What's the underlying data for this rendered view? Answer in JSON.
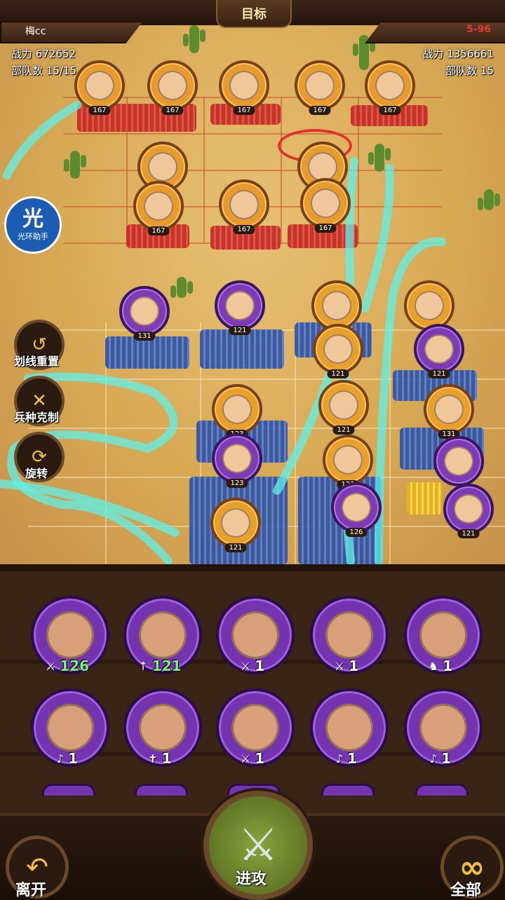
{
  "header": {
    "target_label": "目标"
  },
  "player": {
    "name": "梅cc",
    "power_label": "战力",
    "power": "672652",
    "troops_label": "部队数",
    "troops": "15/15"
  },
  "enemy": {
    "stage": "5-96",
    "power_label": "战力",
    "power": "1356661",
    "troops_label": "部队数",
    "troops": "15"
  },
  "halo_assistant": {
    "glyph": "光",
    "label": "光环助手"
  },
  "side_buttons": [
    {
      "name": "reset-lines",
      "label": "划线重置",
      "icon": "undo-icon"
    },
    {
      "name": "counter-chart",
      "label": "兵种克制",
      "icon": "crossed-swords-icon"
    },
    {
      "name": "rotate",
      "label": "旋转",
      "icon": "rotate-icon"
    }
  ],
  "enemy_units": [
    {
      "count": "167"
    },
    {
      "count": "167"
    },
    {
      "count": "167"
    },
    {
      "count": "167"
    },
    {
      "count": "167"
    },
    {
      "count": "167"
    },
    {
      "count": "167"
    },
    {
      "count": "167"
    },
    {
      "count": "167"
    },
    {
      "count": "167"
    }
  ],
  "ally_units": [
    {
      "count": "131"
    },
    {
      "count": "121"
    },
    {
      "count": "121"
    },
    {
      "count": "121"
    },
    {
      "count": "121"
    },
    {
      "count": "123"
    },
    {
      "count": "121"
    },
    {
      "count": "131"
    },
    {
      "count": "123"
    },
    {
      "count": "123"
    },
    {
      "count": "121"
    },
    {
      "count": "126"
    },
    {
      "count": "121"
    }
  ],
  "roster": [
    {
      "count": "126",
      "type": "sword",
      "highlight": true
    },
    {
      "count": "121",
      "type": "spear",
      "highlight": true
    },
    {
      "count": "1",
      "type": "sword",
      "highlight": false
    },
    {
      "count": "1",
      "type": "sword",
      "highlight": false
    },
    {
      "count": "1",
      "type": "cavalry",
      "highlight": false
    },
    {
      "count": "1",
      "type": "magic",
      "highlight": false
    },
    {
      "count": "1",
      "type": "heal",
      "highlight": false
    },
    {
      "count": "1",
      "type": "sword",
      "highlight": false
    },
    {
      "count": "1",
      "type": "magic",
      "highlight": false
    },
    {
      "count": "1",
      "type": "magic",
      "highlight": false
    }
  ],
  "footer": {
    "leave_label": "离开",
    "attack_label": "进攻",
    "all_label": "全部",
    "all_glyph": "∞"
  },
  "colors": {
    "path": "#5ff0e8",
    "enemy_stage": "#e23a2e",
    "roster_highlight": "#7cf07c"
  }
}
